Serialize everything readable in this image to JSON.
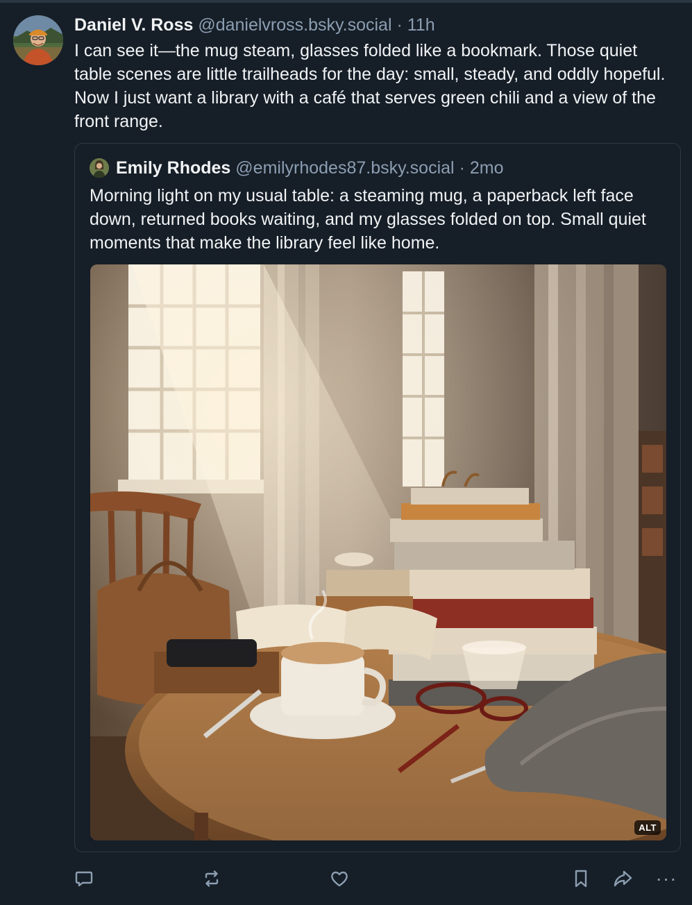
{
  "post": {
    "author_name": "Daniel V. Ross",
    "author_handle": "@danielvross.bsky.social",
    "separator": "·",
    "timestamp": "11h",
    "text": "I can see it—the mug steam, glasses folded like a bookmark. Those quiet table scenes are little trailheads for the day: small, steady, and oddly hopeful. Now I just want a library with a café that serves green chili and a view of the front range."
  },
  "quote": {
    "author_name": "Emily Rhodes",
    "author_handle": "@emilyrhodes87.bsky.social",
    "separator": "·",
    "timestamp": "2mo",
    "text": "Morning light on my usual table: a steaming mug, a paperback left face down, returned books waiting, and my glasses folded on top. Small quiet moments that make the library feel like home.",
    "image_alt_badge": "ALT"
  },
  "actions": {
    "reply_icon": "reply-icon",
    "repost_icon": "repost-icon",
    "like_icon": "heart-icon",
    "bookmark_icon": "bookmark-icon",
    "share_icon": "share-icon",
    "more_label": "···"
  },
  "colors": {
    "background": "#161e27",
    "text_primary": "#f1f3f5",
    "text_secondary": "#8c9eb2",
    "border": "#2e3a47"
  }
}
